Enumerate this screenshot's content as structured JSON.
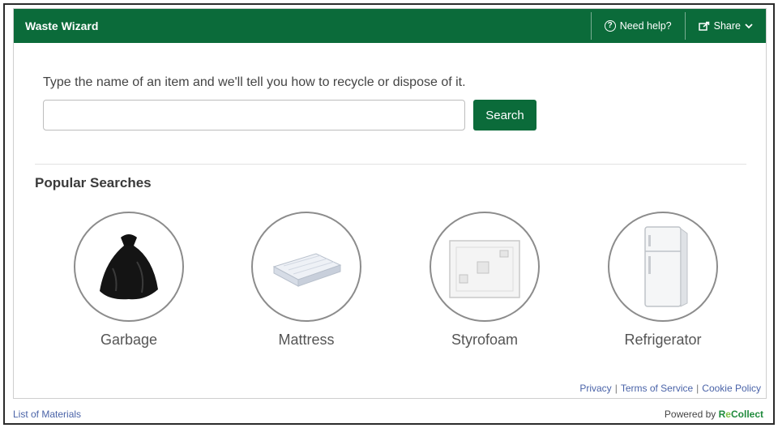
{
  "header": {
    "title": "Waste Wizard",
    "help_label": "Need help?",
    "share_label": "Share"
  },
  "search": {
    "prompt": "Type the name of an item and we'll tell you how to recycle or dispose of it.",
    "value": "",
    "button_label": "Search"
  },
  "popular": {
    "title": "Popular Searches",
    "items": [
      {
        "label": "Garbage",
        "icon": "garbage-bag-icon"
      },
      {
        "label": "Mattress",
        "icon": "mattress-icon"
      },
      {
        "label": "Styrofoam",
        "icon": "styrofoam-icon"
      },
      {
        "label": "Refrigerator",
        "icon": "refrigerator-icon"
      }
    ]
  },
  "footer": {
    "privacy": "Privacy",
    "terms": "Terms of Service",
    "cookie": "Cookie Policy",
    "list_materials": "List of Materials",
    "powered_by": "Powered by",
    "brand_a": "R",
    "brand_b": "Collect"
  },
  "colors": {
    "brand_green": "#0b6b3a",
    "link_blue": "#4a63a8"
  }
}
